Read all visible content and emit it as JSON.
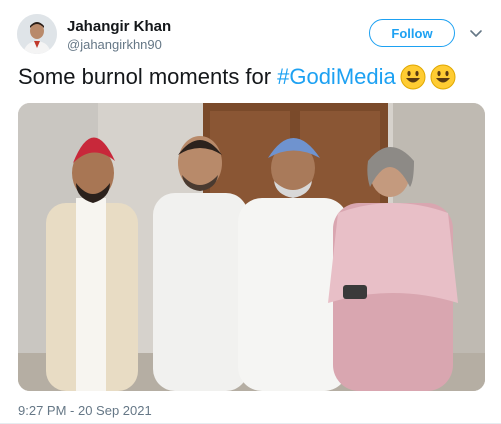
{
  "author": {
    "name": "Jahangir Khan",
    "handle": "@jahangirkhn90"
  },
  "follow_label": "Follow",
  "tweet": {
    "text": "Some burnol moments for",
    "hashtag": "#GodiMedia",
    "emojis": [
      "smiley-emoji",
      "smiley-emoji"
    ]
  },
  "timestamp": "9:27 PM - 20 Sep 2021",
  "colors": {
    "accent": "#1da1f2",
    "secondary_text": "#657786"
  }
}
